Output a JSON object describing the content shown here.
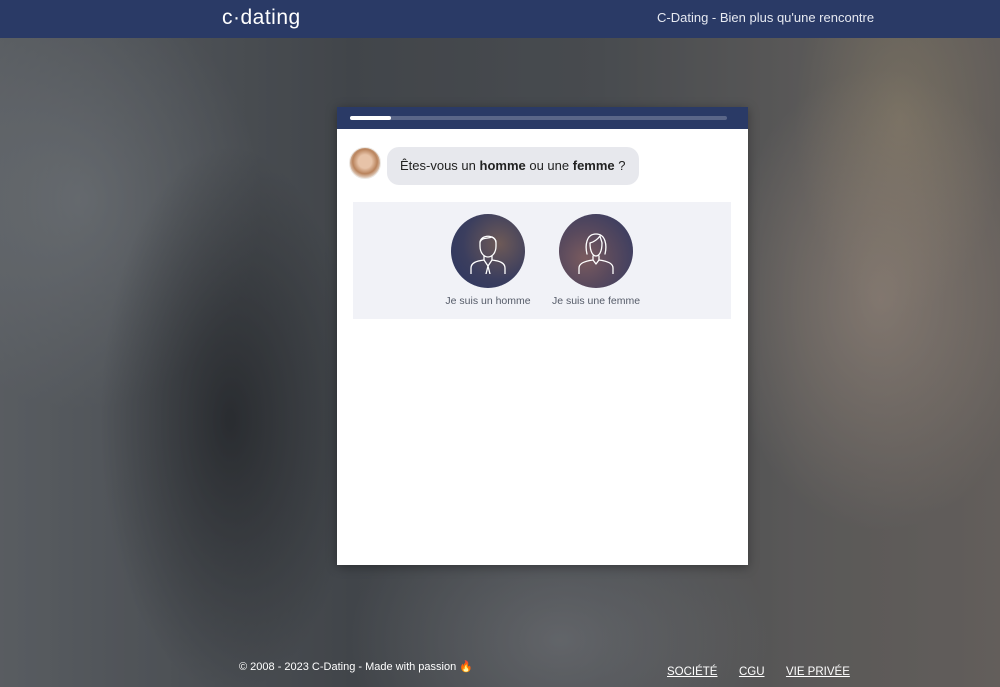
{
  "header": {
    "logo": "c·dating",
    "tagline": "C-Dating - Bien plus qu'une rencontre"
  },
  "card": {
    "progress": 0.11,
    "question": {
      "prefix": "Êtes-vous un ",
      "option1": "homme",
      "middle": " ou une ",
      "option2": "femme",
      "suffix": " ?"
    },
    "choices": [
      {
        "label": "Je suis un homme",
        "icon": "man-icon"
      },
      {
        "label": "Je suis une femme",
        "icon": "woman-icon"
      }
    ]
  },
  "footer": {
    "copyright": "© 2008 - 2023 C-Dating - Made with passion 🔥",
    "links": [
      "SOCIÉTÉ",
      "CGU",
      "VIE PRIVÉE"
    ]
  },
  "colors": {
    "header_bg": "#2a3a66",
    "bubble_bg": "#e7e8ed",
    "choices_bg": "#f1f2f7"
  }
}
